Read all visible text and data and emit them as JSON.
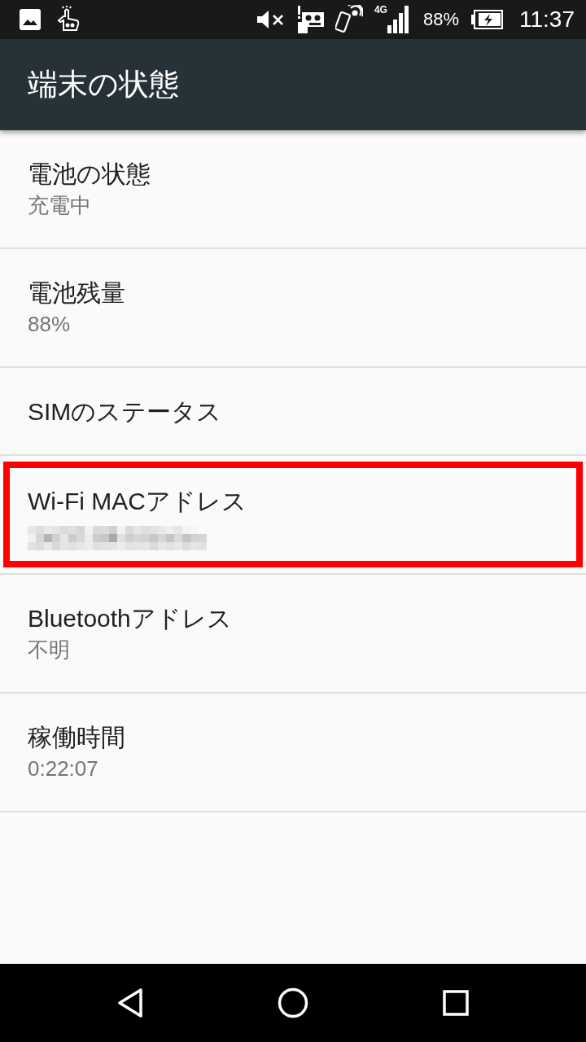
{
  "status_bar": {
    "network_type": "4G",
    "battery": "88%",
    "time": "11:37"
  },
  "app_bar": {
    "title": "端末の状態"
  },
  "items": [
    {
      "title": "電池の状態",
      "summary": "充電中",
      "redacted": false,
      "highlighted": false
    },
    {
      "title": "電池残量",
      "summary": "88%",
      "redacted": false,
      "highlighted": false
    },
    {
      "title": "SIMのステータス",
      "redacted": false,
      "highlighted": false
    },
    {
      "title": "Wi-Fi MACアドレス",
      "redacted": true,
      "highlighted": true
    },
    {
      "title": "Bluetoothアドレス",
      "summary": "不明",
      "redacted": false,
      "highlighted": false
    },
    {
      "title": "稼働時間",
      "summary": "0:22:07",
      "redacted": false,
      "highlighted": false
    }
  ]
}
